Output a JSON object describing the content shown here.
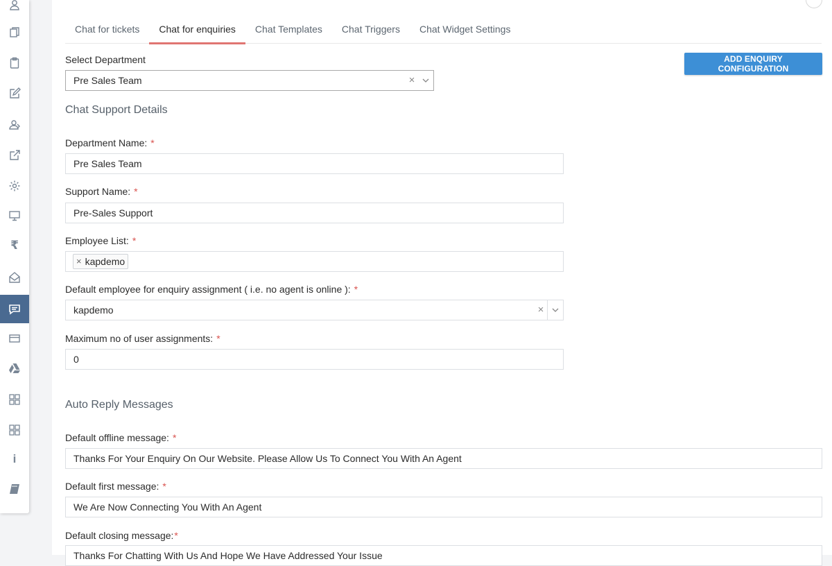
{
  "tabs": [
    {
      "label": "Chat for tickets"
    },
    {
      "label": "Chat for enquiries"
    },
    {
      "label": "Chat Templates"
    },
    {
      "label": "Chat Triggers"
    },
    {
      "label": "Chat Widget Settings"
    }
  ],
  "active_tab": "Chat for enquiries",
  "add_button_label": "ADD ENQUIRY CONFIGURATION",
  "select_department": {
    "label": "Select Department",
    "value": "Pre Sales Team"
  },
  "chat_support_details": {
    "title": "Chat Support Details",
    "department_name": {
      "label": "Department Name:",
      "value": "Pre Sales Team"
    },
    "support_name": {
      "label": "Support Name:",
      "value": "Pre-Sales Support"
    },
    "employee_list": {
      "label": "Employee List:",
      "tags": [
        "kapdemo"
      ]
    },
    "default_employee": {
      "label": "Default employee for enquiry assignment ( i.e. no agent is online ):",
      "value": "kapdemo"
    },
    "max_assignments": {
      "label": "Maximum no of user assignments:",
      "value": "0"
    }
  },
  "auto_reply": {
    "title": "Auto Reply Messages",
    "offline_message": {
      "label": "Default offline message:",
      "value": "Thanks For Your Enquiry On Our Website. Please Allow Us To Connect You With An Agent"
    },
    "first_message": {
      "label": "Default first message:",
      "value": "We Are Now Connecting You With An Agent"
    },
    "closing_message": {
      "label": "Default closing message:",
      "value": "Thanks For Chatting With Us And Hope We Have Addressed Your Issue"
    }
  },
  "required_marker": "*",
  "clear_glyph": "×",
  "sidebar_icons": [
    "users-icon",
    "documents-icon",
    "clipboard-icon",
    "edit-icon",
    "user-group-icon",
    "share-icon",
    "gear-icon",
    "monitor-icon",
    "rupee-icon",
    "mail-icon",
    "chat-icon",
    "credit-card-icon",
    "drive-icon",
    "apps-grid-icon",
    "apps-grid-icon",
    "info-icon",
    "book-icon"
  ],
  "sidebar_rupee_glyph": "₹",
  "sidebar_info_glyph": "i",
  "colors": {
    "accent_tab": "#e07572",
    "primary_button": "#3d8fd6",
    "sidebar_active": "#4a6a91",
    "required": "#d9534f"
  }
}
